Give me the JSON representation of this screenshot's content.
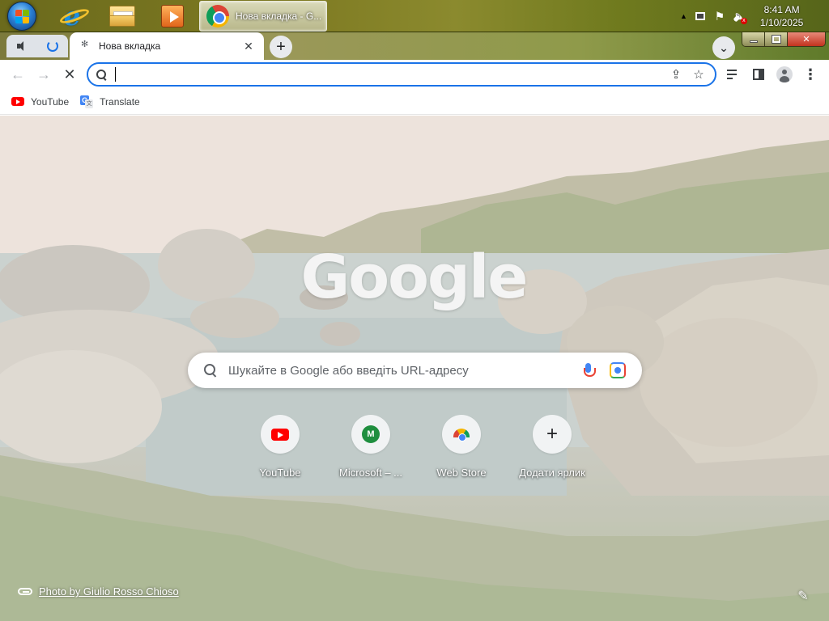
{
  "taskbar": {
    "start_icon": "windows-start-orb",
    "pinned": [
      {
        "name": "internet-explorer",
        "icon": "ie-icon"
      },
      {
        "name": "windows-explorer",
        "icon": "folder-icon"
      },
      {
        "name": "media-player",
        "icon": "media-play-icon"
      }
    ],
    "active_window_label": "Нова вкладка - G...",
    "clock_time": "8:41 AM",
    "clock_date": "1/10/2025"
  },
  "browser": {
    "active_tab_title": "Нова вкладка",
    "new_tab_symbol": "+",
    "tab_close_symbol": "✕",
    "tab_search_symbol": "⌄",
    "omnibox_value": "",
    "accent_color": "#1a73e8"
  },
  "bookmarks": [
    {
      "label": "YouTube",
      "icon": "youtube-icon"
    },
    {
      "label": "Translate",
      "icon": "google-translate-icon"
    }
  ],
  "ntp": {
    "logo_text": "Google",
    "search_placeholder": "Шукайте в Google або введіть URL-адресу",
    "shortcuts": [
      {
        "label": "YouTube",
        "icon": "youtube-icon"
      },
      {
        "label": "Microsoft – ...",
        "icon": "microsoft-m-icon",
        "letter": "M"
      },
      {
        "label": "Web Store",
        "icon": "chrome-web-store-icon"
      },
      {
        "label": "Додати ярлик",
        "icon": "plus-icon"
      }
    ],
    "photo_credit": "Photo by Giulio Rosso Chioso"
  }
}
